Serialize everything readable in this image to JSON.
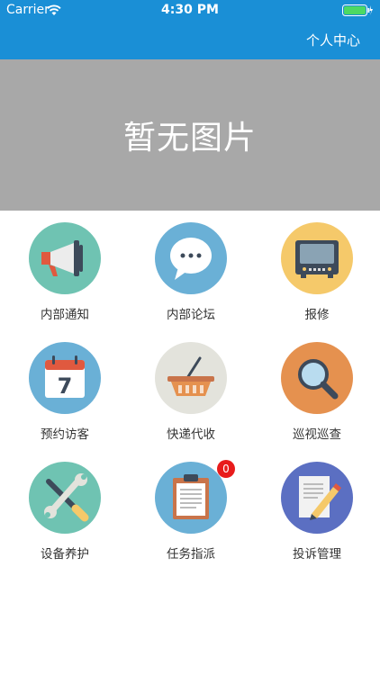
{
  "status_bar": {
    "carrier": "Carrier",
    "time": "4:30 PM"
  },
  "nav": {
    "personal_center": "个人中心"
  },
  "banner": {
    "text": "暂无图片"
  },
  "menu": [
    {
      "label": "内部通知",
      "icon": "megaphone-icon",
      "bg": "#6fc3b2"
    },
    {
      "label": "内部论坛",
      "icon": "chat-bubble-icon",
      "bg": "#6ab0d6"
    },
    {
      "label": "报修",
      "icon": "tv-monitor-icon",
      "bg": "#f5c96a"
    },
    {
      "label": "预约访客",
      "icon": "calendar-icon",
      "bg": "#6ab0d6"
    },
    {
      "label": "快递代收",
      "icon": "basket-icon",
      "bg": "#e3e3dc"
    },
    {
      "label": "巡视巡查",
      "icon": "magnifier-icon",
      "bg": "#e5914f"
    },
    {
      "label": "设备养护",
      "icon": "tools-icon",
      "bg": "#6fc3b2"
    },
    {
      "label": "任务指派",
      "icon": "clipboard-icon",
      "bg": "#6ab0d6",
      "badge": "0"
    },
    {
      "label": "投诉管理",
      "icon": "document-pencil-icon",
      "bg": "#5b6fc2"
    }
  ],
  "calendar_day": "7"
}
